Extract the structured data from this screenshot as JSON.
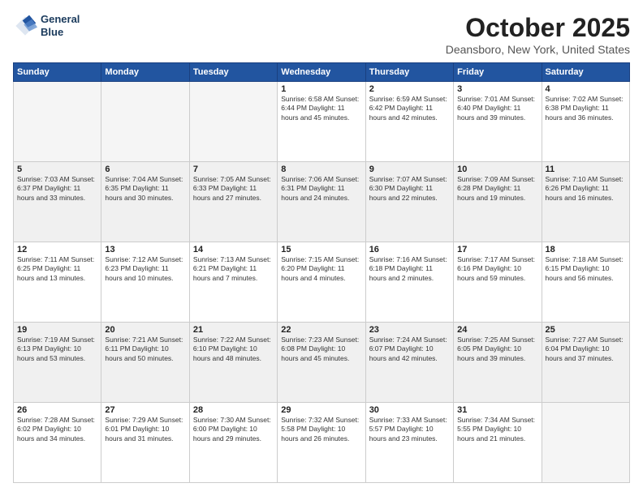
{
  "header": {
    "logo_line1": "General",
    "logo_line2": "Blue",
    "month": "October 2025",
    "location": "Deansboro, New York, United States"
  },
  "days_of_week": [
    "Sunday",
    "Monday",
    "Tuesday",
    "Wednesday",
    "Thursday",
    "Friday",
    "Saturday"
  ],
  "weeks": [
    [
      {
        "day": "",
        "info": "",
        "empty": true
      },
      {
        "day": "",
        "info": "",
        "empty": true
      },
      {
        "day": "",
        "info": "",
        "empty": true
      },
      {
        "day": "1",
        "info": "Sunrise: 6:58 AM\nSunset: 6:44 PM\nDaylight: 11 hours\nand 45 minutes."
      },
      {
        "day": "2",
        "info": "Sunrise: 6:59 AM\nSunset: 6:42 PM\nDaylight: 11 hours\nand 42 minutes."
      },
      {
        "day": "3",
        "info": "Sunrise: 7:01 AM\nSunset: 6:40 PM\nDaylight: 11 hours\nand 39 minutes."
      },
      {
        "day": "4",
        "info": "Sunrise: 7:02 AM\nSunset: 6:38 PM\nDaylight: 11 hours\nand 36 minutes."
      }
    ],
    [
      {
        "day": "5",
        "info": "Sunrise: 7:03 AM\nSunset: 6:37 PM\nDaylight: 11 hours\nand 33 minutes.",
        "shaded": true
      },
      {
        "day": "6",
        "info": "Sunrise: 7:04 AM\nSunset: 6:35 PM\nDaylight: 11 hours\nand 30 minutes.",
        "shaded": true
      },
      {
        "day": "7",
        "info": "Sunrise: 7:05 AM\nSunset: 6:33 PM\nDaylight: 11 hours\nand 27 minutes.",
        "shaded": true
      },
      {
        "day": "8",
        "info": "Sunrise: 7:06 AM\nSunset: 6:31 PM\nDaylight: 11 hours\nand 24 minutes.",
        "shaded": true
      },
      {
        "day": "9",
        "info": "Sunrise: 7:07 AM\nSunset: 6:30 PM\nDaylight: 11 hours\nand 22 minutes.",
        "shaded": true
      },
      {
        "day": "10",
        "info": "Sunrise: 7:09 AM\nSunset: 6:28 PM\nDaylight: 11 hours\nand 19 minutes.",
        "shaded": true
      },
      {
        "day": "11",
        "info": "Sunrise: 7:10 AM\nSunset: 6:26 PM\nDaylight: 11 hours\nand 16 minutes.",
        "shaded": true
      }
    ],
    [
      {
        "day": "12",
        "info": "Sunrise: 7:11 AM\nSunset: 6:25 PM\nDaylight: 11 hours\nand 13 minutes."
      },
      {
        "day": "13",
        "info": "Sunrise: 7:12 AM\nSunset: 6:23 PM\nDaylight: 11 hours\nand 10 minutes."
      },
      {
        "day": "14",
        "info": "Sunrise: 7:13 AM\nSunset: 6:21 PM\nDaylight: 11 hours\nand 7 minutes."
      },
      {
        "day": "15",
        "info": "Sunrise: 7:15 AM\nSunset: 6:20 PM\nDaylight: 11 hours\nand 4 minutes."
      },
      {
        "day": "16",
        "info": "Sunrise: 7:16 AM\nSunset: 6:18 PM\nDaylight: 11 hours\nand 2 minutes."
      },
      {
        "day": "17",
        "info": "Sunrise: 7:17 AM\nSunset: 6:16 PM\nDaylight: 10 hours\nand 59 minutes."
      },
      {
        "day": "18",
        "info": "Sunrise: 7:18 AM\nSunset: 6:15 PM\nDaylight: 10 hours\nand 56 minutes."
      }
    ],
    [
      {
        "day": "19",
        "info": "Sunrise: 7:19 AM\nSunset: 6:13 PM\nDaylight: 10 hours\nand 53 minutes.",
        "shaded": true
      },
      {
        "day": "20",
        "info": "Sunrise: 7:21 AM\nSunset: 6:11 PM\nDaylight: 10 hours\nand 50 minutes.",
        "shaded": true
      },
      {
        "day": "21",
        "info": "Sunrise: 7:22 AM\nSunset: 6:10 PM\nDaylight: 10 hours\nand 48 minutes.",
        "shaded": true
      },
      {
        "day": "22",
        "info": "Sunrise: 7:23 AM\nSunset: 6:08 PM\nDaylight: 10 hours\nand 45 minutes.",
        "shaded": true
      },
      {
        "day": "23",
        "info": "Sunrise: 7:24 AM\nSunset: 6:07 PM\nDaylight: 10 hours\nand 42 minutes.",
        "shaded": true
      },
      {
        "day": "24",
        "info": "Sunrise: 7:25 AM\nSunset: 6:05 PM\nDaylight: 10 hours\nand 39 minutes.",
        "shaded": true
      },
      {
        "day": "25",
        "info": "Sunrise: 7:27 AM\nSunset: 6:04 PM\nDaylight: 10 hours\nand 37 minutes.",
        "shaded": true
      }
    ],
    [
      {
        "day": "26",
        "info": "Sunrise: 7:28 AM\nSunset: 6:02 PM\nDaylight: 10 hours\nand 34 minutes."
      },
      {
        "day": "27",
        "info": "Sunrise: 7:29 AM\nSunset: 6:01 PM\nDaylight: 10 hours\nand 31 minutes."
      },
      {
        "day": "28",
        "info": "Sunrise: 7:30 AM\nSunset: 6:00 PM\nDaylight: 10 hours\nand 29 minutes."
      },
      {
        "day": "29",
        "info": "Sunrise: 7:32 AM\nSunset: 5:58 PM\nDaylight: 10 hours\nand 26 minutes."
      },
      {
        "day": "30",
        "info": "Sunrise: 7:33 AM\nSunset: 5:57 PM\nDaylight: 10 hours\nand 23 minutes."
      },
      {
        "day": "31",
        "info": "Sunrise: 7:34 AM\nSunset: 5:55 PM\nDaylight: 10 hours\nand 21 minutes."
      },
      {
        "day": "",
        "info": "",
        "empty": true
      }
    ]
  ]
}
